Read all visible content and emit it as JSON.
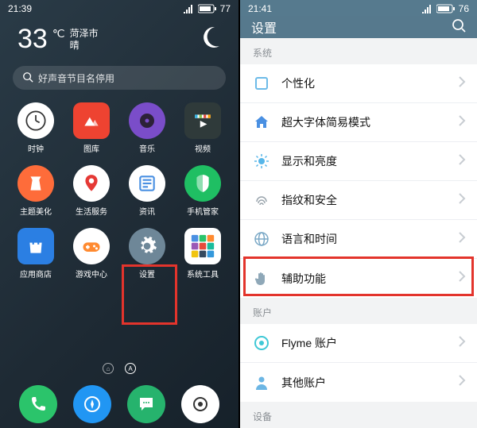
{
  "left": {
    "status": {
      "time": "21:39",
      "battery": "77"
    },
    "weather": {
      "temp": "33",
      "unit": "℃",
      "city": "菏泽市",
      "cond": "晴"
    },
    "search_placeholder": "好声音节目名停用",
    "apps": [
      {
        "name": "clock",
        "label": "时钟",
        "bg": "#ffffff"
      },
      {
        "name": "gallery",
        "label": "图库",
        "bg": "#ee4331"
      },
      {
        "name": "music",
        "label": "音乐",
        "bg": "#7a4dc9"
      },
      {
        "name": "video",
        "label": "视频",
        "bg": "#2f3a3a"
      },
      {
        "name": "theme",
        "label": "主题美化",
        "bg": "#fe6c3a"
      },
      {
        "name": "life",
        "label": "生活服务",
        "bg": "#ffffff"
      },
      {
        "name": "news",
        "label": "资讯",
        "bg": "#ffffff"
      },
      {
        "name": "guard",
        "label": "手机管家",
        "bg": "#1fbf63"
      },
      {
        "name": "store",
        "label": "应用商店",
        "bg": "#2b7fe3"
      },
      {
        "name": "games",
        "label": "游戏中心",
        "bg": "#ffffff"
      },
      {
        "name": "settings",
        "label": "设置",
        "bg": "#6e8798"
      },
      {
        "name": "tools",
        "label": "系统工具",
        "bg": "#ffffff"
      }
    ],
    "dock": [
      {
        "name": "phone",
        "bg": "#2bc46b"
      },
      {
        "name": "browser",
        "bg": "#2196f3"
      },
      {
        "name": "messages",
        "bg": "#26b36d"
      },
      {
        "name": "camera",
        "bg": "#ffffff"
      }
    ],
    "page_ind": {
      "home_glyph": "⌂",
      "all_glyph": "A"
    }
  },
  "right": {
    "status": {
      "time": "21:41",
      "battery": "76"
    },
    "header": {
      "title": "设置"
    },
    "section_system": "系统",
    "rows": [
      {
        "name": "personalize",
        "label": "个性化",
        "color": "#6dbbe8"
      },
      {
        "name": "bigfont",
        "label": "超大字体简易模式",
        "color": "#4a90e2"
      },
      {
        "name": "display",
        "label": "显示和亮度",
        "color": "#57b6e9"
      },
      {
        "name": "security",
        "label": "指纹和安全",
        "color": "#9aa5ad"
      },
      {
        "name": "language",
        "label": "语言和时间",
        "color": "#7aa8c6"
      },
      {
        "name": "a11y",
        "label": "辅助功能",
        "color": "#8fa8b8"
      }
    ],
    "section_account": "账户",
    "account_rows": [
      {
        "name": "flyme",
        "label": "Flyme 账户",
        "color": "#3fc8d6"
      },
      {
        "name": "other",
        "label": "其他账户",
        "color": "#6cb6e4"
      }
    ],
    "section_device": "设备"
  }
}
